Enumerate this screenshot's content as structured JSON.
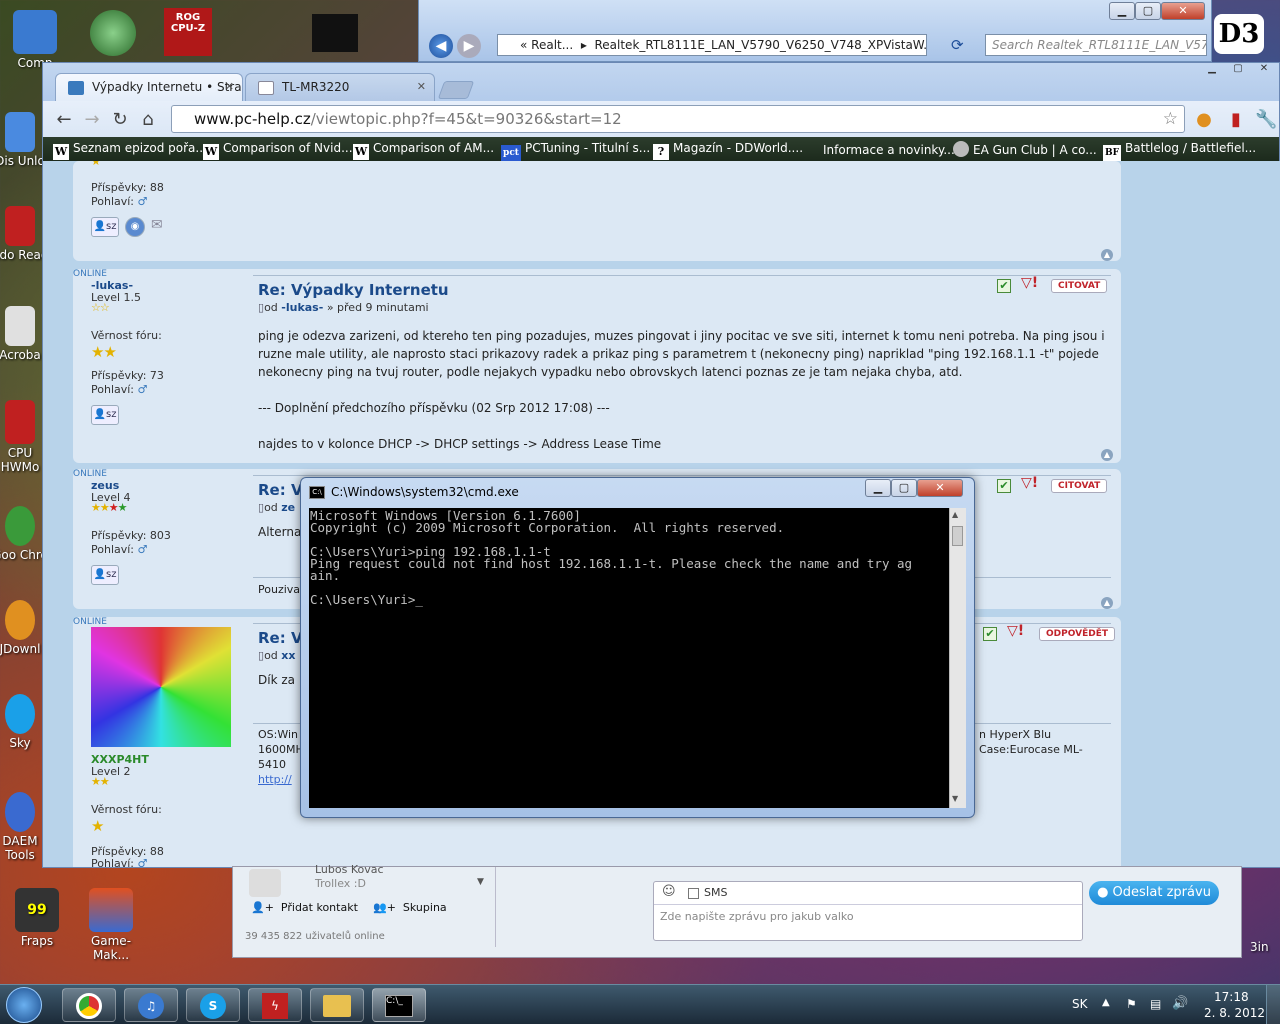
{
  "desktop": {
    "icons": [
      {
        "label": "Comp",
        "color": "#3a7ad0"
      },
      {
        "label": "Dis Unlo",
        "color": "#4a8ae0"
      },
      {
        "label": "Ado Read",
        "color": "#c02020"
      },
      {
        "label": "Acroba",
        "color": "#e0e0e0"
      },
      {
        "label": "CPU HWMo",
        "color": "#c02020"
      },
      {
        "label": "Goo Chro",
        "color": "#3a9a3a"
      },
      {
        "label": "JDownl",
        "color": "#e09020"
      },
      {
        "label": "Sky",
        "color": "#1aa0e8"
      },
      {
        "label": "DAEM Tools",
        "color": "#3a6ad0"
      }
    ],
    "bottom_icons": [
      {
        "label": "Fraps",
        "badge": "99"
      },
      {
        "label": "Game-Mak..."
      }
    ],
    "right_text": "3in"
  },
  "explorer": {
    "address_prefix": "«",
    "address_seg1": "Realt...",
    "address_seg2": "Realtek_RTL8111E_LAN_V5790_V6250_V748_XPVistaW...",
    "search_placeholder": "Search Realtek_RTL8111E_LAN_V57..."
  },
  "chrome": {
    "tabs": [
      {
        "label": "Výpadky Internetu • Strana",
        "active": true
      },
      {
        "label": "TL-MR3220",
        "active": false
      }
    ],
    "url_host": "www.pc-help.cz",
    "url_path": "/viewtopic.php?f=45&t=90326&start=12",
    "bookmarks": [
      {
        "icon": "W",
        "label": "Seznam epizod pořa..."
      },
      {
        "icon": "W",
        "label": "Comparison of Nvid..."
      },
      {
        "icon": "W",
        "label": "Comparison of AM..."
      },
      {
        "icon": "pct",
        "label": "PCTuning - Titulní s..."
      },
      {
        "icon": "?",
        "label": "Magazín - DDWorld...."
      },
      {
        "icon": "",
        "label": "Informace a novinky..."
      },
      {
        "icon": "",
        "label": "EA Gun Club | A co..."
      },
      {
        "icon": "BF",
        "label": "Battlelog / Battlefiel..."
      }
    ]
  },
  "forum": {
    "labels": {
      "posts": "Příspěvky:",
      "gender": "Pohlaví:",
      "loyalty": "Věrnost fóru:",
      "online": "ONLINE",
      "quote": "CITOVAT",
      "reply": "ODPOVĚDĚT"
    },
    "post0": {
      "posts": "88"
    },
    "post1": {
      "user": "-lukas-",
      "level": "Level 1.5",
      "posts": "73",
      "title": "Re: Výpadky Internetu",
      "meta_from": "od",
      "meta_user": "-lukas-",
      "meta_time": "» před 9 minutami",
      "line1": "ping je odezva zarizeni, od ktereho ten ping pozadujes, muzes pingovat i jiny pocitac ve sve siti, internet k tomu neni potreba. Na ping jsou i",
      "line2": "ruzne male utility, ale naprosto staci prikazovy radek a prikaz ping s parametrem t (nekonecny ping) napriklad \"ping 192.168.1.1 -t\" pojede",
      "line3": "nekonecny ping na tvuj router, podle nejakych vypadku nebo obrovskych latenci poznas ze je tam nejaka chyba, atd.",
      "line4": "--- Doplnění předchozího příspěvku (02 Srp 2012 17:08) ---",
      "line5": "najdes to v kolonce DHCP -> DHCP settings -> Address Lease Time"
    },
    "post2": {
      "user": "zeus",
      "level": "Level 4",
      "posts": "803",
      "title": "Re: Vý",
      "meta_from": "od",
      "meta_user": "ze",
      "text": "Alterna",
      "sig": "Pouziva"
    },
    "post3": {
      "user": "XXXP4HT",
      "level": "Level 2",
      "posts": "88",
      "title": "Re: Vý",
      "meta_from": "od",
      "meta_user": "xx",
      "text": "Dík za",
      "sig1": "OS:Win",
      "sig2": "1600MH",
      "sig3": "5410",
      "sig_link": "http://",
      "sig_right1": "n HyperX Blu",
      "sig_right2": "Case:Eurocase ML-"
    }
  },
  "cmd": {
    "title": "C:\\Windows\\system32\\cmd.exe",
    "lines": [
      "Microsoft Windows [Version 6.1.7600]",
      "Copyright (c) 2009 Microsoft Corporation.  All rights reserved.",
      "",
      "C:\\Users\\Yuri>ping 192.168.1.1-t",
      "Ping request could not find host 192.168.1.1-t. Please check the name and try ag",
      "ain.",
      "",
      "C:\\Users\\Yuri>_"
    ]
  },
  "skype": {
    "contact_name": "Lubos Kovac",
    "contact_status": "Trollex :D",
    "add_contact": "Přidat kontakt",
    "group": "Skupina",
    "online_count": "39 435 822 uživatelů online",
    "sms_label": "SMS",
    "message_placeholder": "Zde napište zprávu pro jakub valko",
    "send_button": "Odeslat zprávu"
  },
  "taskbar": {
    "lang": "SK",
    "time": "17:18",
    "date": "2. 8. 2012"
  }
}
